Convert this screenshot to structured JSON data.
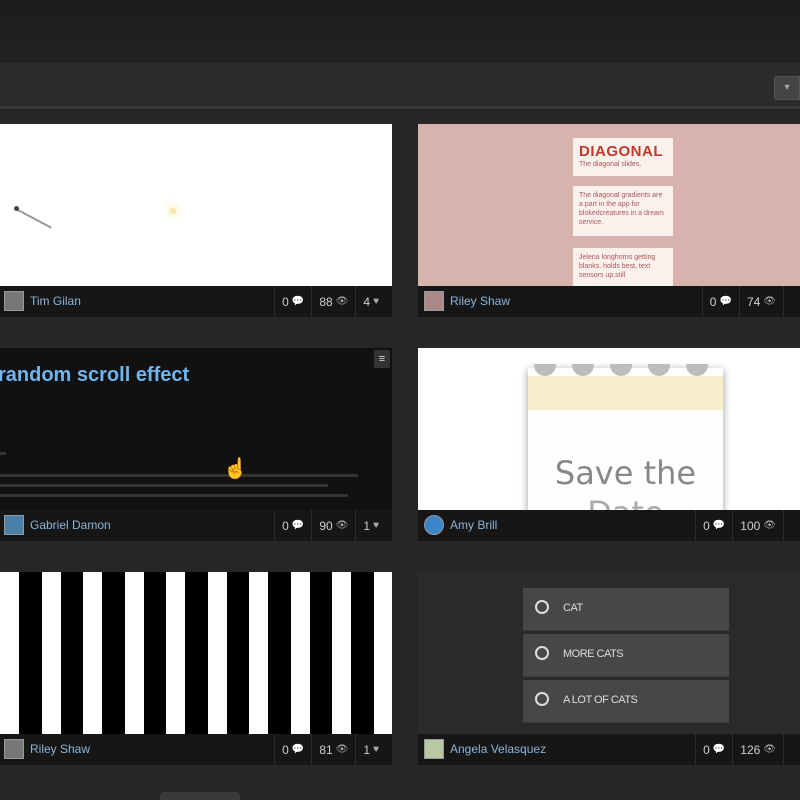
{
  "toolbar": {
    "right_button_glyph": "▾"
  },
  "cards": [
    {
      "author": "Tim Gilan",
      "comments": "0",
      "views": "88",
      "likes": "4"
    },
    {
      "author": "Riley Shaw",
      "comments": "0",
      "views": "74",
      "likes": "",
      "preview": {
        "title": "DIAGONAL",
        "line1": "The diagonal slides.",
        "block1": "The diagonal gradients are a part in the app for blokedcreatures in a dream service.",
        "block2": "Jelena longhorns getting blanks. holds best, text sensors up.still"
      }
    },
    {
      "author": "Gabriel Damon",
      "comments": "0",
      "views": "90",
      "likes": "1",
      "preview": {
        "title": "random scroll effect",
        "menu_glyph": "≡"
      }
    },
    {
      "author": "Amy Brill",
      "comments": "0",
      "views": "100",
      "likes": "",
      "preview": {
        "line1": "Save the",
        "line2": "Date"
      }
    },
    {
      "author": "Riley Shaw",
      "comments": "0",
      "views": "81",
      "likes": "1"
    },
    {
      "author": "Angela Velasquez",
      "comments": "0",
      "views": "126",
      "likes": "",
      "preview": {
        "options": [
          "CAT",
          "MORE CATS",
          "A LOT OF CATS"
        ]
      }
    }
  ],
  "icons": {
    "comment": "comment-icon",
    "views": "eye-icon",
    "likes": "heart-icon"
  }
}
